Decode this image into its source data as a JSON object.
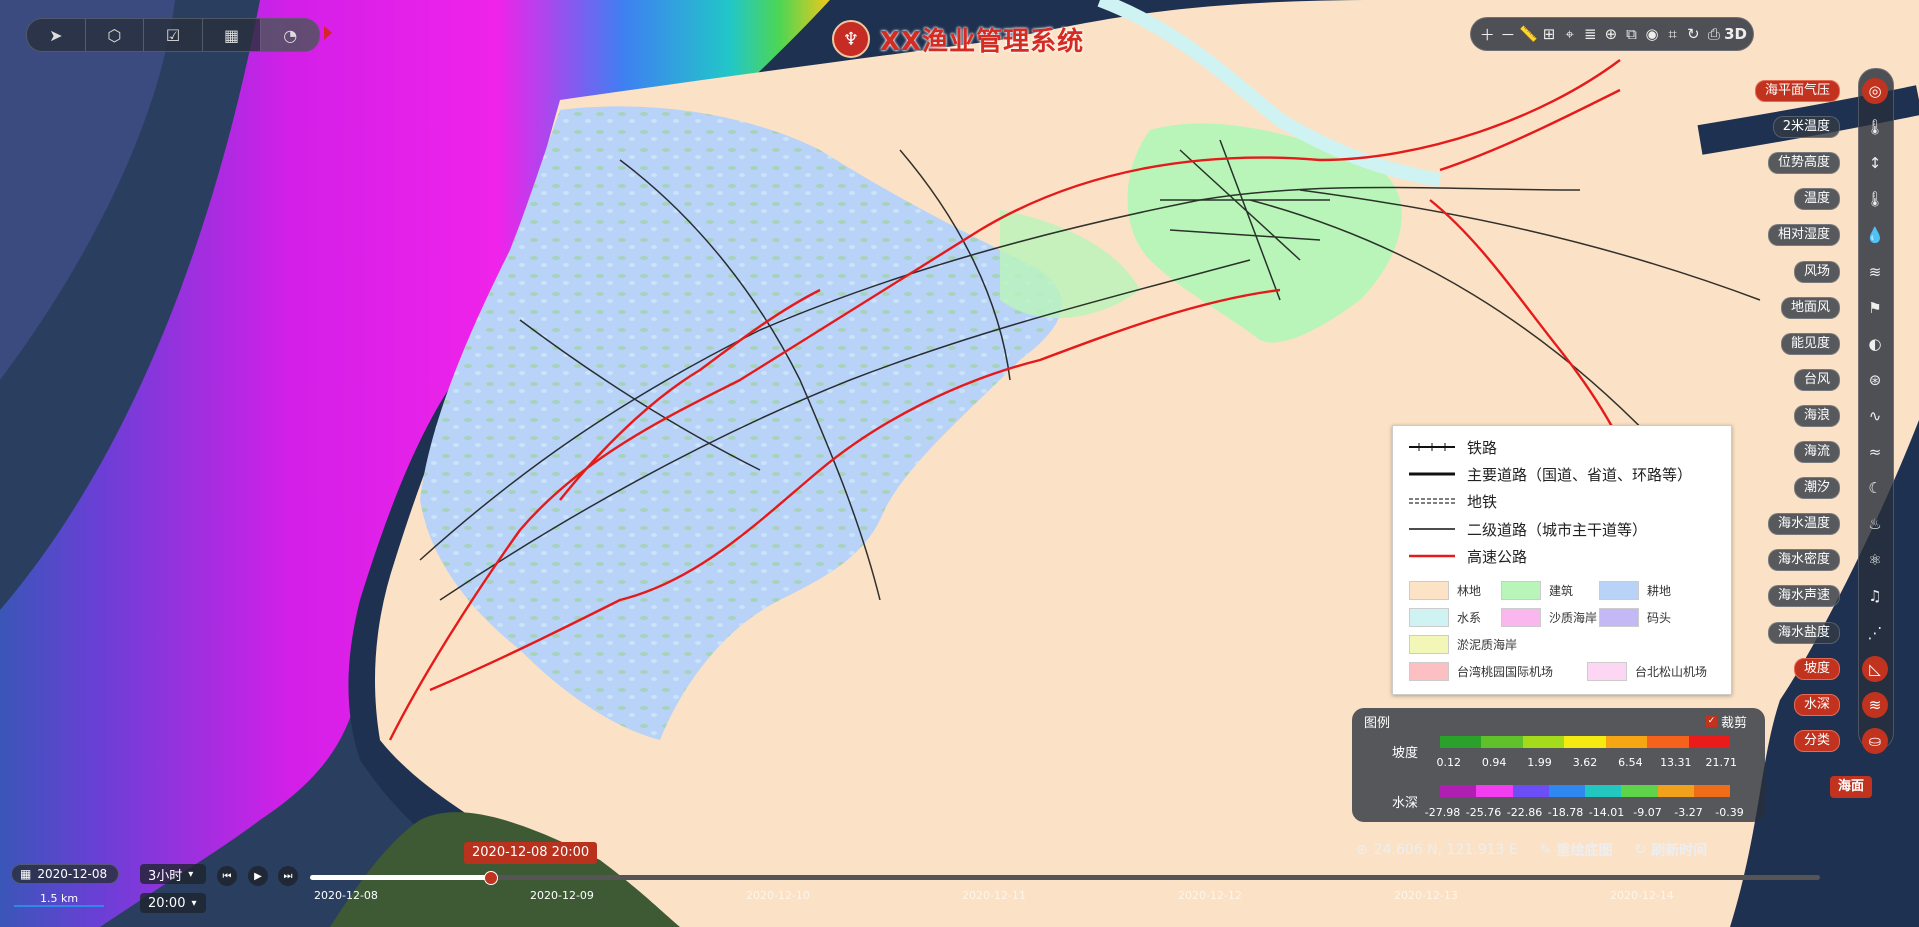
{
  "app": {
    "title": "XX渔业管理系统",
    "logo_glyph": "♆"
  },
  "top_left_toolbar": {
    "icons": [
      "navigate-arrow-icon",
      "cube-icon",
      "clipboard-icon",
      "grid-icon",
      "pie-chart-icon"
    ]
  },
  "top_right_toolbar": {
    "icons": [
      "zoom-in-icon",
      "zoom-out-icon",
      "ruler-icon",
      "area-measure-icon",
      "locate-icon",
      "layers-icon",
      "globe-icon",
      "add-frame-icon",
      "target-icon",
      "crop-icon",
      "rotate-icon",
      "screenshot-icon"
    ],
    "mode_label": "3D"
  },
  "layers": [
    {
      "label": "海平面气压",
      "icon": "compass-icon",
      "active": true
    },
    {
      "label": "2米温度",
      "icon": "thermometer-icon",
      "active": false
    },
    {
      "label": "位势高度",
      "icon": "height-icon",
      "active": false
    },
    {
      "label": "温度",
      "icon": "thermometer-icon",
      "active": false
    },
    {
      "label": "相对湿度",
      "icon": "droplet-icon",
      "active": false
    },
    {
      "label": "风场",
      "icon": "wind-icon",
      "active": false
    },
    {
      "label": "地面风",
      "icon": "wind-flag-icon",
      "active": false
    },
    {
      "label": "能见度",
      "icon": "visibility-icon",
      "active": false
    },
    {
      "label": "台风",
      "icon": "typhoon-icon",
      "active": false
    },
    {
      "label": "海浪",
      "icon": "wave-icon",
      "active": false
    },
    {
      "label": "海流",
      "icon": "current-icon",
      "active": false
    },
    {
      "label": "潮汐",
      "icon": "tide-icon",
      "active": false
    },
    {
      "label": "海水温度",
      "icon": "sea-temp-icon",
      "active": false
    },
    {
      "label": "海水密度",
      "icon": "density-icon",
      "active": false
    },
    {
      "label": "海水声速",
      "icon": "sound-icon",
      "active": false
    },
    {
      "label": "海水盐度",
      "icon": "salinity-icon",
      "active": false
    },
    {
      "label": "坡度",
      "icon": "slope-icon",
      "active": true
    },
    {
      "label": "水深",
      "icon": "depth-icon",
      "active": true
    },
    {
      "label": "分类",
      "icon": "classify-icon",
      "active": true
    }
  ],
  "haimian_label": "海面",
  "legend": {
    "lines": [
      {
        "label": "铁路",
        "style": "rail"
      },
      {
        "label": "主要道路（国道、省道、环路等）",
        "style": "major"
      },
      {
        "label": "地铁",
        "style": "metro"
      },
      {
        "label": "二级道路（城市主干道等）",
        "style": "minor"
      },
      {
        "label": "高速公路",
        "style": "highway"
      }
    ],
    "areas": [
      {
        "label": "林地",
        "color": "#fde3c6"
      },
      {
        "label": "建筑",
        "color": "#b9f5b9"
      },
      {
        "label": "耕地",
        "color": "#b8d3f7"
      },
      {
        "label": "水系",
        "color": "#cff3f2"
      },
      {
        "label": "沙质海岸",
        "color": "#f9b7ee"
      },
      {
        "label": "码头",
        "color": "#c4b8f5"
      },
      {
        "label": "淤泥质海岸",
        "color": "#f2f7b8"
      },
      {
        "label": "台湾桃园国际机场",
        "color": "#fdc0c2"
      },
      {
        "label": "台北松山机场",
        "color": "#fcd6f3"
      }
    ]
  },
  "color_legend": {
    "title": "图例",
    "clip_label": "裁剪",
    "clip_mark": "✓",
    "slope": {
      "name": "坡度",
      "ticks": [
        "0.12",
        "0.94",
        "1.99",
        "3.62",
        "6.54",
        "13.31",
        "21.71"
      ],
      "colors": [
        "#2aa12a",
        "#5fc22a",
        "#a4dc1c",
        "#f5ea12",
        "#f7a613",
        "#f5621b",
        "#ea1b1b"
      ]
    },
    "depth": {
      "name": "水深",
      "ticks": [
        "-27.98",
        "-25.76",
        "-22.86",
        "-18.78",
        "-14.01",
        "-9.07",
        "-3.27",
        "-0.39"
      ],
      "colors": [
        "#b01fb2",
        "#f23ef0",
        "#6b4ef5",
        "#2f87f0",
        "#22c7c0",
        "#5ed44a",
        "#f2a11a",
        "#ee6d16"
      ]
    }
  },
  "status": {
    "coords": "24.606 N, 121.913 E",
    "redraw_label": "重绘底图",
    "refresh_label": "刷新时间"
  },
  "timeline": {
    "current_date": "2020-12-08",
    "map_scale": "1.5 km",
    "interval": "3小时",
    "hour": "20:00",
    "current_tip": "2020-12-08 20:00",
    "dates": [
      "2020-12-08",
      "2020-12-09",
      "2020-12-10",
      "2020-12-11",
      "2020-12-12",
      "2020-12-13",
      "2020-12-14"
    ],
    "dot_count": 48
  }
}
